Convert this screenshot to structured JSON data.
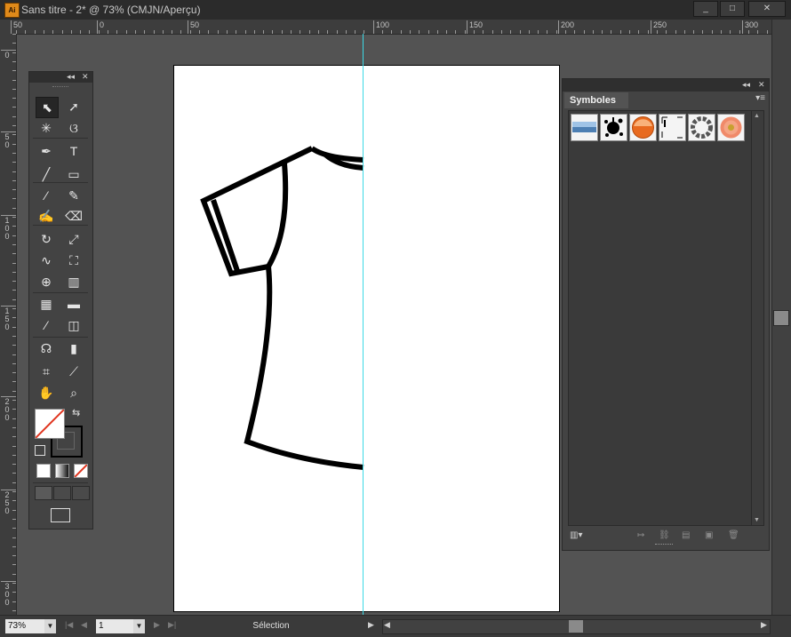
{
  "window": {
    "title": "Sans titre - 2* @ 73% (CMJN/Aperçu)",
    "app_logo": "Ai",
    "minimize": "_",
    "maximize": "□",
    "close": "✕"
  },
  "ruler_top": {
    "labels": [
      "50",
      "0",
      "50",
      "100",
      "150",
      "200",
      "250",
      "300"
    ]
  },
  "ruler_left": {
    "labels": [
      "0",
      "50",
      "100",
      "150",
      "200",
      "250",
      "300"
    ]
  },
  "tools_panel": {
    "header_collapse": "◂◂",
    "header_close": "✕",
    "tools": [
      {
        "name": "selection-tool",
        "glyph": "⬉"
      },
      {
        "name": "direct-selection-tool",
        "glyph": "➚"
      },
      {
        "name": "magic-wand-tool",
        "glyph": "✳"
      },
      {
        "name": "lasso-tool",
        "glyph": "ଓ"
      },
      {
        "name": "pen-tool",
        "glyph": "✒"
      },
      {
        "name": "type-tool",
        "glyph": "T"
      },
      {
        "name": "line-segment-tool",
        "glyph": "╱"
      },
      {
        "name": "rectangle-tool",
        "glyph": "▭"
      },
      {
        "name": "paintbrush-tool",
        "glyph": "⁄"
      },
      {
        "name": "pencil-tool",
        "glyph": "✎"
      },
      {
        "name": "blob-brush-tool",
        "glyph": "✍"
      },
      {
        "name": "eraser-tool",
        "glyph": "⌫"
      },
      {
        "name": "rotate-tool",
        "glyph": "↻"
      },
      {
        "name": "scale-tool",
        "glyph": "⤢"
      },
      {
        "name": "warp-tool",
        "glyph": "∿"
      },
      {
        "name": "free-transform-tool",
        "glyph": "⛶"
      },
      {
        "name": "shape-builder-tool",
        "glyph": "⊕"
      },
      {
        "name": "perspective-grid-tool",
        "glyph": "▥"
      },
      {
        "name": "mesh-tool",
        "glyph": "▦"
      },
      {
        "name": "gradient-tool",
        "glyph": "▬"
      },
      {
        "name": "eyedropper-tool",
        "glyph": "⁄"
      },
      {
        "name": "blend-tool",
        "glyph": "◫"
      },
      {
        "name": "symbol-sprayer-tool",
        "glyph": "☊"
      },
      {
        "name": "column-graph-tool",
        "glyph": "▮"
      },
      {
        "name": "artboard-tool",
        "glyph": "⌗"
      },
      {
        "name": "slice-tool",
        "glyph": "⟋"
      },
      {
        "name": "hand-tool",
        "glyph": "✋"
      },
      {
        "name": "zoom-tool",
        "glyph": "⌕"
      }
    ]
  },
  "symbols_panel": {
    "header_collapse": "◂◂",
    "header_close": "✕",
    "tab_label": "Symboles",
    "menu_glyph": "▾≡",
    "symbols": [
      "banner-symbol",
      "splatter-symbol",
      "orange-button-symbol",
      "corner-marks-symbol",
      "ring-symbol",
      "flower-symbol"
    ],
    "footer": [
      "▥▾",
      "↦",
      "⛓",
      "▤",
      "▣",
      "🗑"
    ]
  },
  "status_bar": {
    "zoom_value": "73%",
    "page_value": "1",
    "status_text": "Sélection",
    "first": "|◀",
    "prev": "◀",
    "next": "▶",
    "last": "▶|",
    "status_arrow": "▶",
    "scroll_left": "◀",
    "scroll_right": "▶"
  },
  "colors": {
    "guide": "#3cd9e6",
    "accent_orange": "#e08a1a",
    "selection_fill": "#262626"
  }
}
